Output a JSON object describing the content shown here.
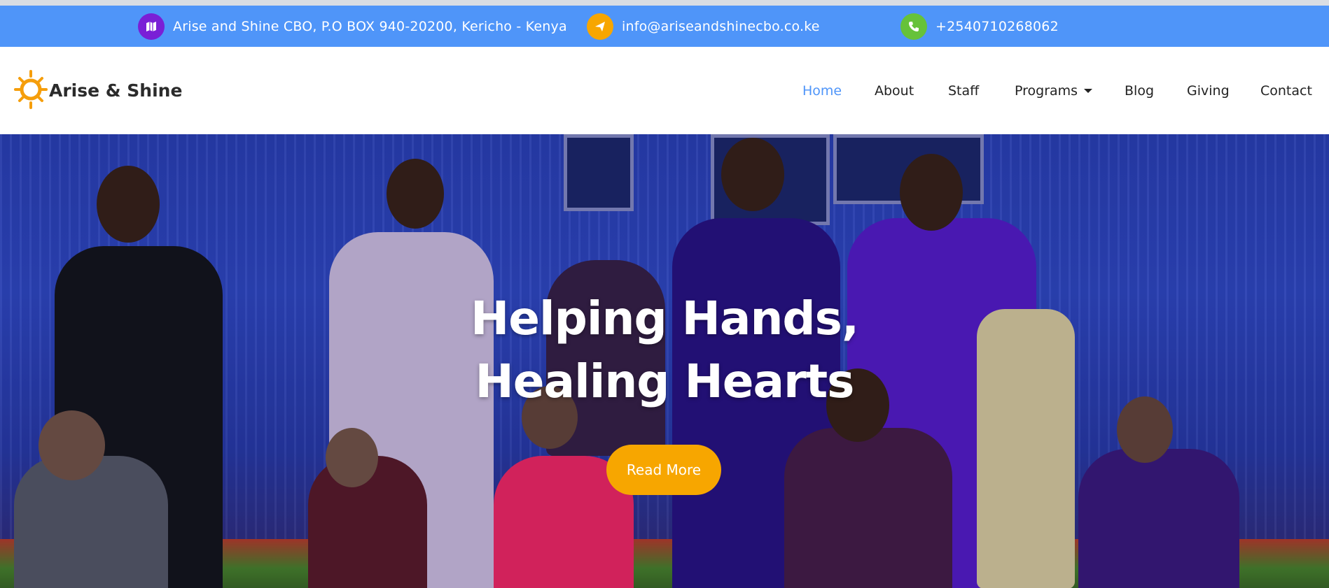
{
  "topbar": {
    "address": "Arise and Shine CBO, P.O BOX 940-20200, Kericho - Kenya",
    "email": "info@ariseandshinecbo.co.ke",
    "phone": "+2540710268062",
    "address_icon": "map-icon",
    "email_icon": "paper-plane-icon",
    "phone_icon": "phone-icon",
    "colors": {
      "bar": "#4f95f9",
      "address_icon_bg": "#7a1fd6",
      "email_icon_bg": "#f7a600",
      "phone_icon_bg": "#66c23a"
    }
  },
  "brand": {
    "name": "Arise & Shine",
    "logo": "sun-logo",
    "logo_color": "#f59e0b"
  },
  "nav": {
    "items": [
      {
        "label": "Home",
        "active": true
      },
      {
        "label": "About"
      },
      {
        "label": "Staff"
      },
      {
        "label": "Programs",
        "dropdown": true
      },
      {
        "label": "Blog"
      },
      {
        "label": "Giving"
      },
      {
        "label": "Contact"
      }
    ],
    "active_color": "#4f95f9"
  },
  "hero": {
    "title_line1": "Helping Hands,",
    "title_line2": "Healing Hearts",
    "button_label": "Read More",
    "button_color": "#f7a600"
  }
}
